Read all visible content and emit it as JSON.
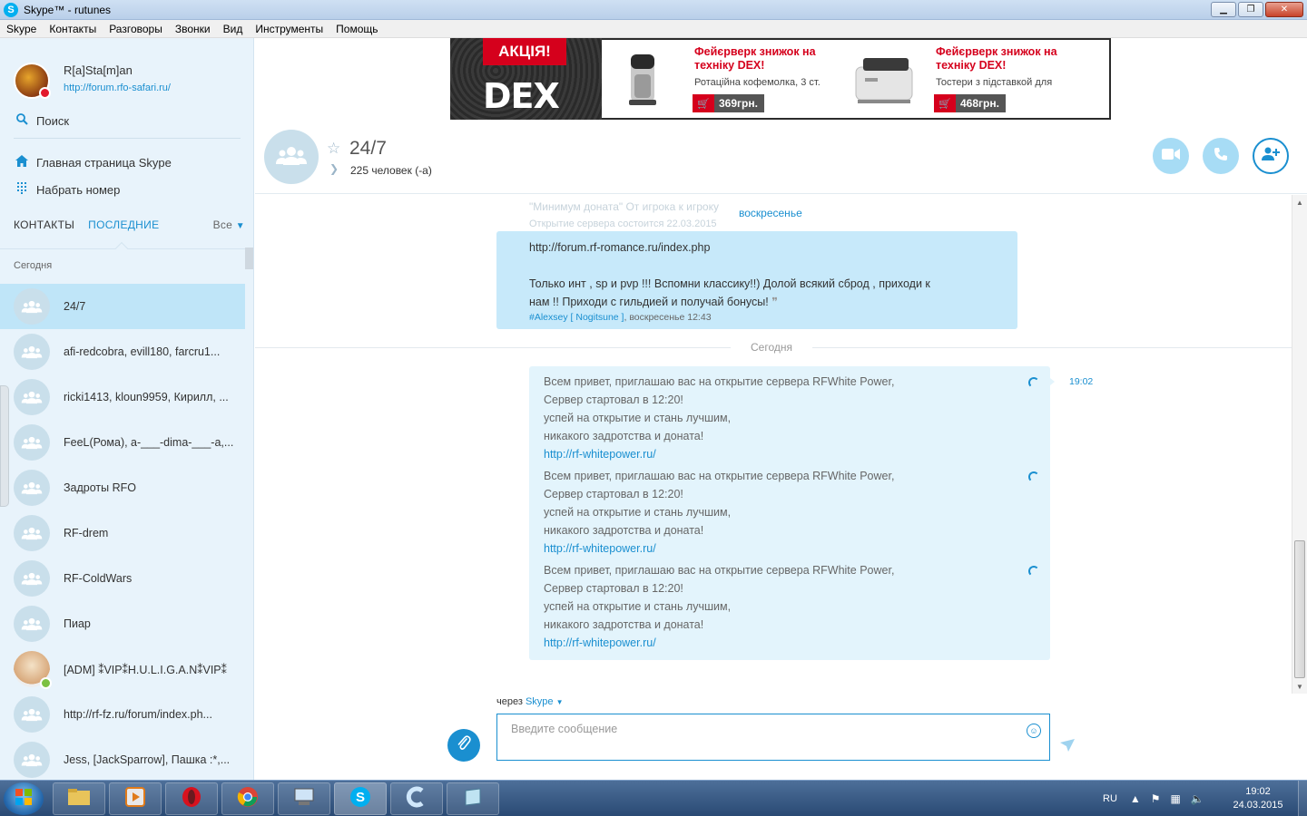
{
  "window": {
    "title": "Skype™ - rutunes",
    "buttons": [
      "▁",
      "❐",
      "✕"
    ]
  },
  "menu": [
    "Skype",
    "Контакты",
    "Разговоры",
    "Звонки",
    "Вид",
    "Инструменты",
    "Помощь"
  ],
  "profile": {
    "name": "R[a]Sta[m]an",
    "mood": "http://forum.rfo-safari.ru/"
  },
  "sidebar": {
    "search_label": "Поиск",
    "home_label": "Главная страница Skype",
    "dial_label": "Набрать номер",
    "tab_contacts": "КОНТАКТЫ",
    "tab_recent": "ПОСЛЕДНИЕ",
    "filter_label": "Все",
    "section_today": "Сегодня",
    "conversations": [
      {
        "name": "24/7",
        "selected": true,
        "type": "group"
      },
      {
        "name": "afi-redcobra, evill180, farcru1...",
        "type": "group"
      },
      {
        "name": "ricki1413, kloun9959, Кирилл, ...",
        "type": "group"
      },
      {
        "name": "FeeL(Рома), a-___-dima-___-a,...",
        "type": "group"
      },
      {
        "name": "Задроты RFO",
        "type": "group"
      },
      {
        "name": "RF-drem",
        "type": "group"
      },
      {
        "name": "RF-ColdWars",
        "type": "group"
      },
      {
        "name": "Пиар",
        "type": "group"
      },
      {
        "name": "[ADM] ⁑VIP⁑H.U.L.I.G.A.N⁑VIP⁑",
        "type": "person"
      },
      {
        "name": "http://rf-fz.ru/forum/index.ph...",
        "type": "group"
      },
      {
        "name": "Jess, [JackSparrow], Пашка :*,...",
        "type": "group"
      }
    ]
  },
  "ad": {
    "badge": "АКЦІЯ!",
    "brand": "DEX",
    "products": [
      {
        "title": "Фейєрверк знижок на техніку DEX!",
        "subtitle": "Ротаційна кофемолка, 3 ст.",
        "price": "369грн."
      },
      {
        "title": "Фейєрверк знижок на техніку DEX!",
        "subtitle": "Тостери з підставкой для",
        "price": "468грн."
      }
    ]
  },
  "chat": {
    "title": "24/7",
    "members": "225 человек (-а)",
    "faded_line1": "\"Минимум доната\" От игрока к игроку",
    "faded_line2": "Открытие сервера состоится 22.03.2015",
    "day_old": "воскресенье",
    "old_message": {
      "line1": "http://forum.rf-romance.ru/index.php",
      "line2": "Только инт , sp и pvp !!! Вспомни классику!!) Долой всякий сброд , приходи к",
      "line3": "нам !! Приходи с гильдией и получай бонусы!",
      "author": "#Alexsey [ Nogitsune ]",
      "meta": ", воскресенье 12:43"
    },
    "day_today": "Сегодня",
    "time": "19:02",
    "messages": [
      {
        "l1": "Всем привет, приглашаю вас на открытие сервера RFWhite Power,",
        "l2": "Сервер стартовал в 12:20!",
        "l3": "успей на открытие и стань лучшим,",
        "l4": "никакого задротства и доната!",
        "link": "http://rf-whitepower.ru/"
      },
      {
        "l1": "Всем привет, приглашаю вас на открытие сервера RFWhite Power,",
        "l2": "Сервер стартовал в 12:20!",
        "l3": "успей на открытие и стань лучшим,",
        "l4": "никакого задротства и доната!",
        "link": "http://rf-whitepower.ru/"
      },
      {
        "l1": "Всем привет, приглашаю вас на открытие сервера RFWhite Power,",
        "l2": "Сервер стартовал в 12:20!",
        "l3": "успей на открытие и стань лучшим,",
        "l4": "никакого задротства и доната!",
        "link": "http://rf-whitepower.ru/"
      }
    ]
  },
  "compose": {
    "via_label": "через",
    "via_service": "Skype",
    "placeholder": "Введите сообщение"
  },
  "taskbar": {
    "lang": "RU",
    "time": "19:02",
    "date": "24.03.2015"
  },
  "colors": {
    "accent": "#1a8fd0",
    "sidebar_bg": "#e8f3fb",
    "selected_bg": "#bfe5f8",
    "bubble_new": "#e3f4fc",
    "bubble_old": "#c7e9fa"
  }
}
